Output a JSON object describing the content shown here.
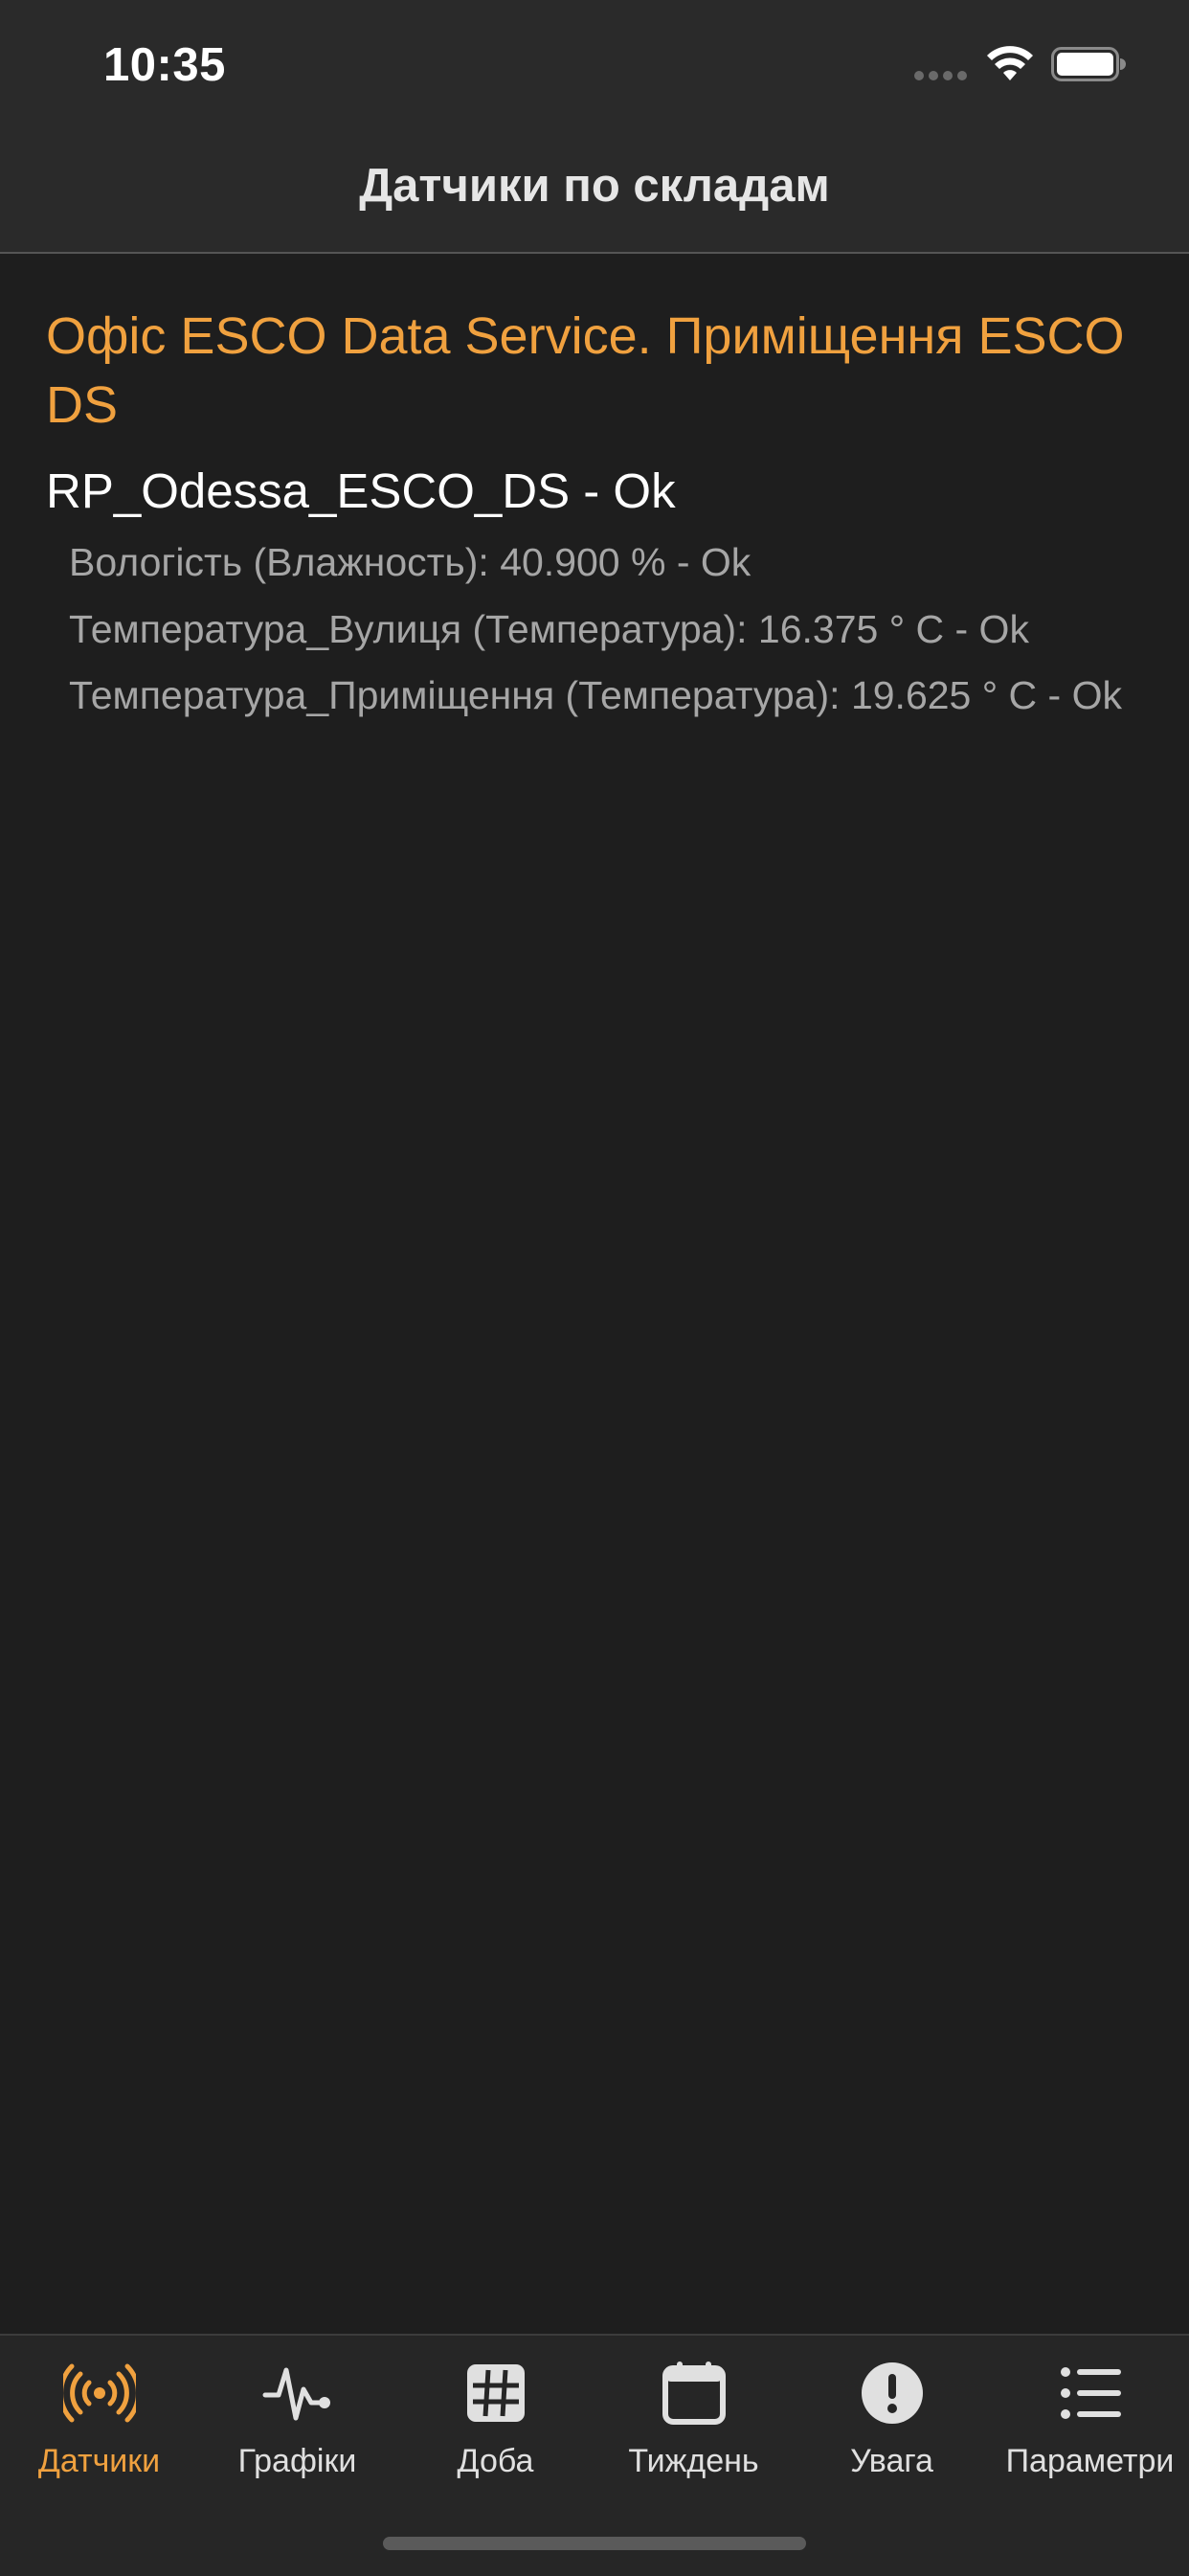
{
  "status_bar": {
    "time": "10:35"
  },
  "nav": {
    "title": "Датчики по складам"
  },
  "group": {
    "title": "Офіс ESCO Data Service. Приміщення ESCO DS",
    "device": {
      "title": "RP_Odessa_ESCO_DS - Ok",
      "sensors": [
        "Вологість (Влажность): 40.900 % - Ok",
        "Температура_Вулиця (Температура): 16.375 ° C - Ok",
        "Температура_Приміщення (Температура): 19.625 ° C - Ok"
      ]
    }
  },
  "tabs": [
    {
      "label": "Датчики",
      "icon": "sensors-icon",
      "active": true
    },
    {
      "label": "Графіки",
      "icon": "waveform-icon",
      "active": false
    },
    {
      "label": "Доба",
      "icon": "grid-icon",
      "active": false
    },
    {
      "label": "Тиждень",
      "icon": "calendar-icon",
      "active": false
    },
    {
      "label": "Увага",
      "icon": "alert-icon",
      "active": false
    },
    {
      "label": "Параметри",
      "icon": "list-icon",
      "active": false
    }
  ],
  "colors": {
    "accent": "#f0a13f",
    "background": "#1e1e1e",
    "bar": "#2a2a2a"
  }
}
